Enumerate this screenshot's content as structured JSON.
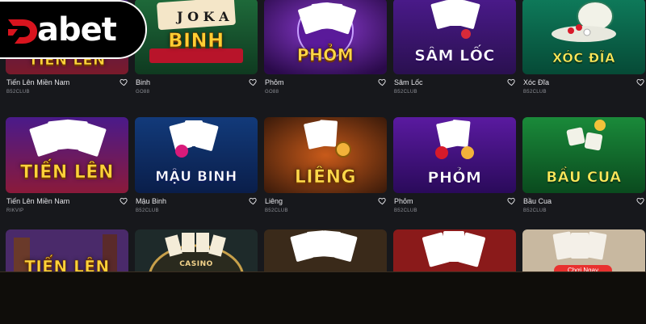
{
  "brand": {
    "name": "Dabet",
    "wordmark": "abet"
  },
  "colors": {
    "page_bg": "#17181c",
    "play_button": "#e8312f"
  },
  "games": [
    {
      "name": "Tiến Lên Miền Nam",
      "source": "B52CLUB",
      "title_art": "TIẾN LÊN",
      "icon": "heart-icon"
    },
    {
      "name": "Binh",
      "source": "GO88",
      "title_art": "BINH",
      "icon": "heart-icon"
    },
    {
      "name": "Phỏm",
      "source": "GO88",
      "title_art": "PHỎM",
      "icon": "heart-icon"
    },
    {
      "name": "Sâm Lốc",
      "source": "B52CLUB",
      "title_art": "SÂM LỐC",
      "icon": "heart-icon"
    },
    {
      "name": "Xóc Đĩa",
      "source": "B52CLUB",
      "title_art": "XÓC ĐĨA",
      "icon": "heart-icon"
    },
    {
      "name": "Tiến Lên Miền Nam",
      "source": "RIKVIP",
      "title_art": "TIẾN LÊN",
      "icon": "heart-icon"
    },
    {
      "name": "Mậu Binh",
      "source": "B52CLUB",
      "title_art": "MẬU BINH",
      "icon": "heart-icon"
    },
    {
      "name": "Liêng",
      "source": "B52CLUB",
      "title_art": "LIÊNG",
      "icon": "heart-icon"
    },
    {
      "name": "Phỏm",
      "source": "B52CLUB",
      "title_art": "PHỎM",
      "icon": "heart-icon"
    },
    {
      "name": "Bầu Cua",
      "source": "B52CLUB",
      "title_art": "BẦU CUA",
      "icon": "heart-icon"
    }
  ],
  "partial_row": [
    {
      "title_art": "TIẾN LÊN"
    },
    {
      "title_art": "CASINO"
    },
    {
      "title_art": ""
    },
    {
      "title_art": ""
    },
    {
      "title_art": ""
    }
  ],
  "play_button_label": "Chơi Ngay"
}
